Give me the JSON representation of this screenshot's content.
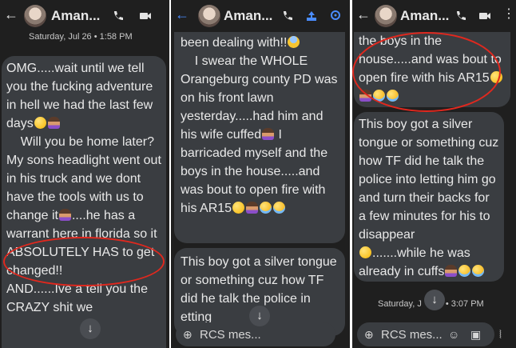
{
  "panels": [
    {
      "header": {
        "back_icon": "←",
        "contact_name": "Aman...",
        "icons": [
          "phone-icon",
          "video-icon"
        ]
      },
      "timestamp": "Saturday, Jul 26 • 1:58 PM",
      "message": "OMG.....wait until we tell you the fucking adventure in hell we had the last few days",
      "message_b": "    Will you be home later? My sons headlight went out in his truck and we dont have the tools with us to change it",
      "message_c": "....he has a warrant here in florida so it ABSOLUTELY HAS to get changed!!\nAND......Ive",
      "message_d": "a tell you the CRAZY shit we"
    },
    {
      "header": {
        "back_icon": "←",
        "contact_name": "Aman...",
        "icons": [
          "phone-icon",
          "upload-icon",
          "location-icon"
        ]
      },
      "message_top_a": "been dealing with!!",
      "message_top_b": "    I swear the WHOLE Orangeburg county PD was on his front lawn yesterday.....had him and his wife cuffed",
      "message_top_c": " I barricaded myself and the boys in the house.....and was bout to open fire with his AR15",
      "message_bottom_a": "This boy got a silver tongue or something cuz how TF di",
      "message_bottom_b": "d he talk the police in",
      "message_bottom_c": "etting",
      "composer_placeholder": "RCS mes..."
    },
    {
      "header": {
        "back_icon": "←",
        "contact_name": "Aman...",
        "icons": [
          "phone-icon",
          "video-icon",
          "more-icon"
        ]
      },
      "message_top": "the boys in the house.....and was bout to open fire with his AR15",
      "message_bottom_a": "This boy got a silver tongue or something cuz how TF did he talk the police into letting him go and turn their backs for a few minutes for his to disappear",
      "message_bottom_b": ".......while he was already in cuffs",
      "timestamp_a": "Saturday, J",
      "timestamp_b": "• 3:07 PM",
      "composer_placeholder": "RCS mes..."
    }
  ],
  "accent_colors": {
    "bubble": "#3a3d41",
    "background": "#1f1f1f",
    "annotation_oval": "#e0281e"
  }
}
